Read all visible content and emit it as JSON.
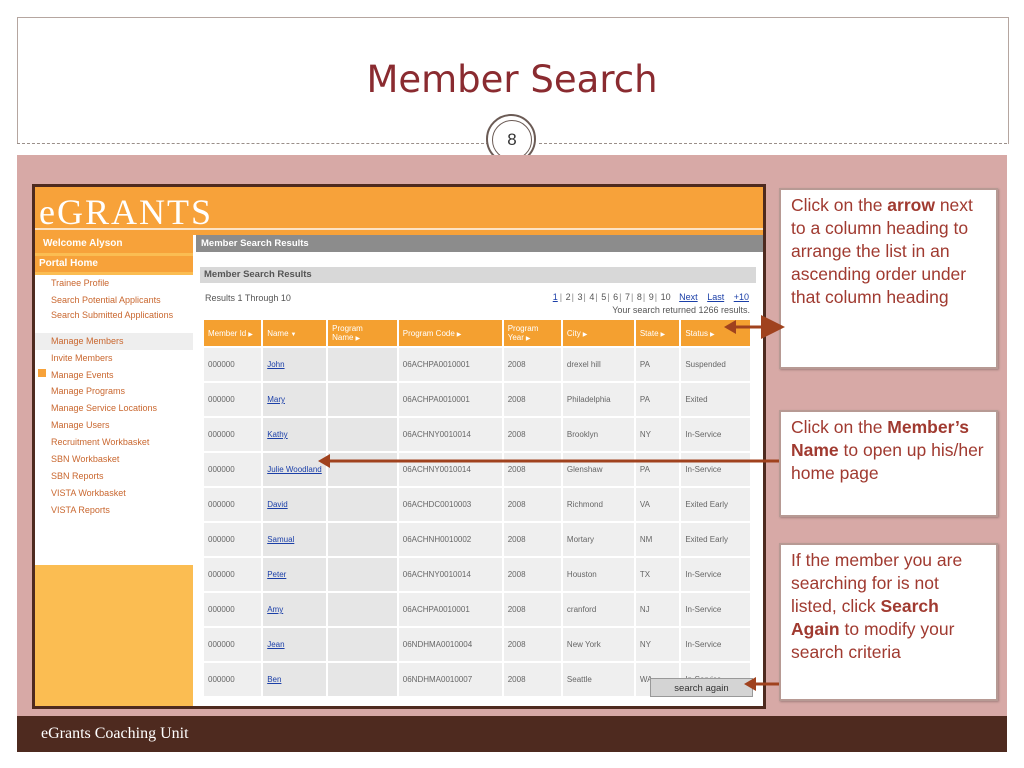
{
  "slide": {
    "title": "Member Search",
    "number": "8",
    "footer": "eGrants Coaching Unit"
  },
  "app": {
    "logo": "eGRANTS",
    "welcome": "Welcome Alyson",
    "portal_home": "Portal Home",
    "menu": [
      {
        "label": "Trainee Profile"
      },
      {
        "label": "Search Potential Applicants"
      },
      {
        "label": "Search Submitted Applications"
      },
      {
        "label": "Manage Members"
      },
      {
        "label": "Invite Members"
      },
      {
        "label": "Manage Events"
      },
      {
        "label": "Manage Programs"
      },
      {
        "label": "Manage Service Locations"
      },
      {
        "label": "Manage Users"
      },
      {
        "label": "Recruitment Workbasket"
      },
      {
        "label": "SBN Workbasket"
      },
      {
        "label": "SBN Reports"
      },
      {
        "label": "VISTA Workbasket"
      },
      {
        "label": "VISTA Reports"
      }
    ],
    "main_header": "Member Search Results",
    "sub_header": "Member Search Results",
    "results_range": "Results 1 Through 10",
    "pager": {
      "pages": [
        "1",
        "2",
        "3",
        "4",
        "5",
        "6",
        "7",
        "8",
        "9",
        "10"
      ],
      "next": "Next",
      "last": "Last",
      "plus10": "+10"
    },
    "result_count": "Your search returned 1266 results.",
    "columns": [
      "Member Id",
      "Name",
      "Program Name",
      "Program Code",
      "Program Year",
      "City",
      "State",
      "Status"
    ],
    "rows": [
      {
        "id": "000000",
        "name": "John",
        "program_name": "",
        "code": "06ACHPA0010001",
        "year": "2008",
        "city": "drexel hill",
        "state": "PA",
        "status": "Suspended"
      },
      {
        "id": "000000",
        "name": "Mary",
        "program_name": "",
        "code": "06ACHPA0010001",
        "year": "2008",
        "city": "Philadelphia",
        "state": "PA",
        "status": "Exited"
      },
      {
        "id": "000000",
        "name": "Kathy",
        "program_name": "",
        "code": "06ACHNY0010014",
        "year": "2008",
        "city": "Brooklyn",
        "state": "NY",
        "status": "In-Service"
      },
      {
        "id": "000000",
        "name": "Julie Woodland",
        "program_name": "",
        "code": "06ACHNY0010014",
        "year": "2008",
        "city": "Glenshaw",
        "state": "PA",
        "status": "In-Service"
      },
      {
        "id": "000000",
        "name": "David",
        "program_name": "",
        "code": "06ACHDC0010003",
        "year": "2008",
        "city": "Richmond",
        "state": "VA",
        "status": "Exited Early"
      },
      {
        "id": "000000",
        "name": "Samual",
        "program_name": "",
        "code": "06ACHNH0010002",
        "year": "2008",
        "city": "Mortary",
        "state": "NM",
        "status": "Exited Early"
      },
      {
        "id": "000000",
        "name": "Peter",
        "program_name": "",
        "code": "06ACHNY0010014",
        "year": "2008",
        "city": "Houston",
        "state": "TX",
        "status": "In-Service"
      },
      {
        "id": "000000",
        "name": "Amy",
        "program_name": "",
        "code": "06ACHPA0010001",
        "year": "2008",
        "city": "cranford",
        "state": "NJ",
        "status": "In-Service"
      },
      {
        "id": "000000",
        "name": "Jean",
        "program_name": "",
        "code": "06NDHMA0010004",
        "year": "2008",
        "city": "New York",
        "state": "NY",
        "status": "In-Service"
      },
      {
        "id": "000000",
        "name": "Ben",
        "program_name": "",
        "code": "06NDHMA0010007",
        "year": "2008",
        "city": "Seattle",
        "state": "WA",
        "status": "In-Service"
      }
    ],
    "search_again": "search again"
  },
  "callouts": {
    "c1": {
      "pre": "Click on the ",
      "bold": "arrow",
      "post": " next to a column heading to arrange the list in an ascending order under that column heading"
    },
    "c2": {
      "pre": "Click on the ",
      "bold": "Member’s Name",
      "post": " to open up his/her home page"
    },
    "c3": {
      "pre": "If the member you are searching for is not listed, click ",
      "bold": "Search Again",
      "post": " to modify your search criteria"
    }
  },
  "colors": {
    "accent": "#f7a23a",
    "title": "#8a2b30",
    "footer": "#4e2a1f",
    "callout_text": "#a03a30",
    "arrow": "#a0421e"
  }
}
